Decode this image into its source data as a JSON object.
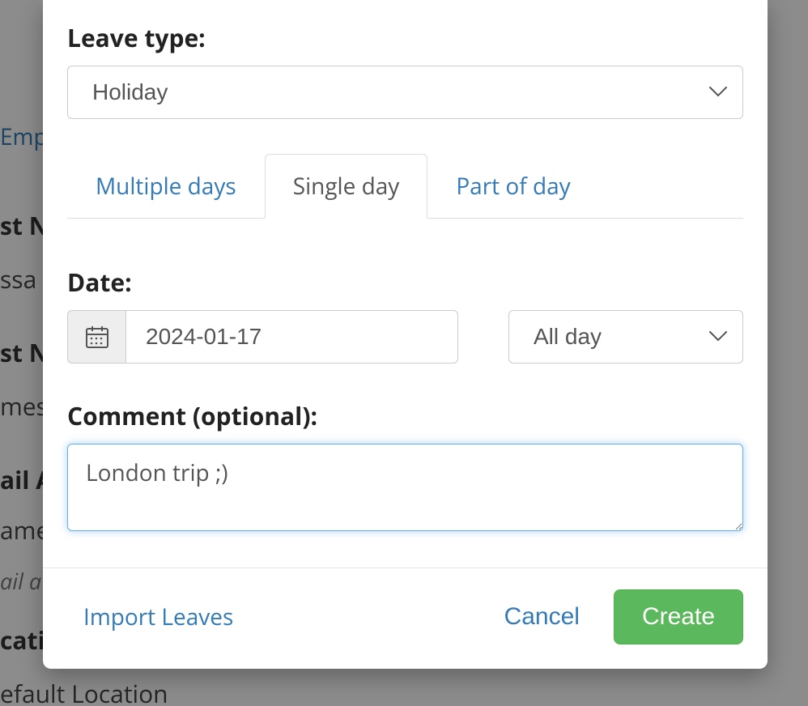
{
  "background": {
    "nav_employees": "Emp",
    "first_name_label": "st Na",
    "first_name_value": "ssa",
    "last_name_label": "st Na",
    "last_name_value": "mes",
    "email_label": "ail A",
    "email_value": "ame",
    "email_hint": "ail a",
    "location_label": "catio",
    "location_value": "efault Location"
  },
  "form": {
    "leave_type_label": "Leave type:",
    "leave_type_value": "Holiday",
    "tabs": {
      "multiple": "Multiple days",
      "single": "Single day",
      "part": "Part of day"
    },
    "date_label": "Date:",
    "date_value": "2024-01-17",
    "day_part_value": "All day",
    "comment_label": "Comment (optional):",
    "comment_value": "London trip ;)"
  },
  "footer": {
    "import": "Import Leaves",
    "cancel": "Cancel",
    "create": "Create"
  }
}
